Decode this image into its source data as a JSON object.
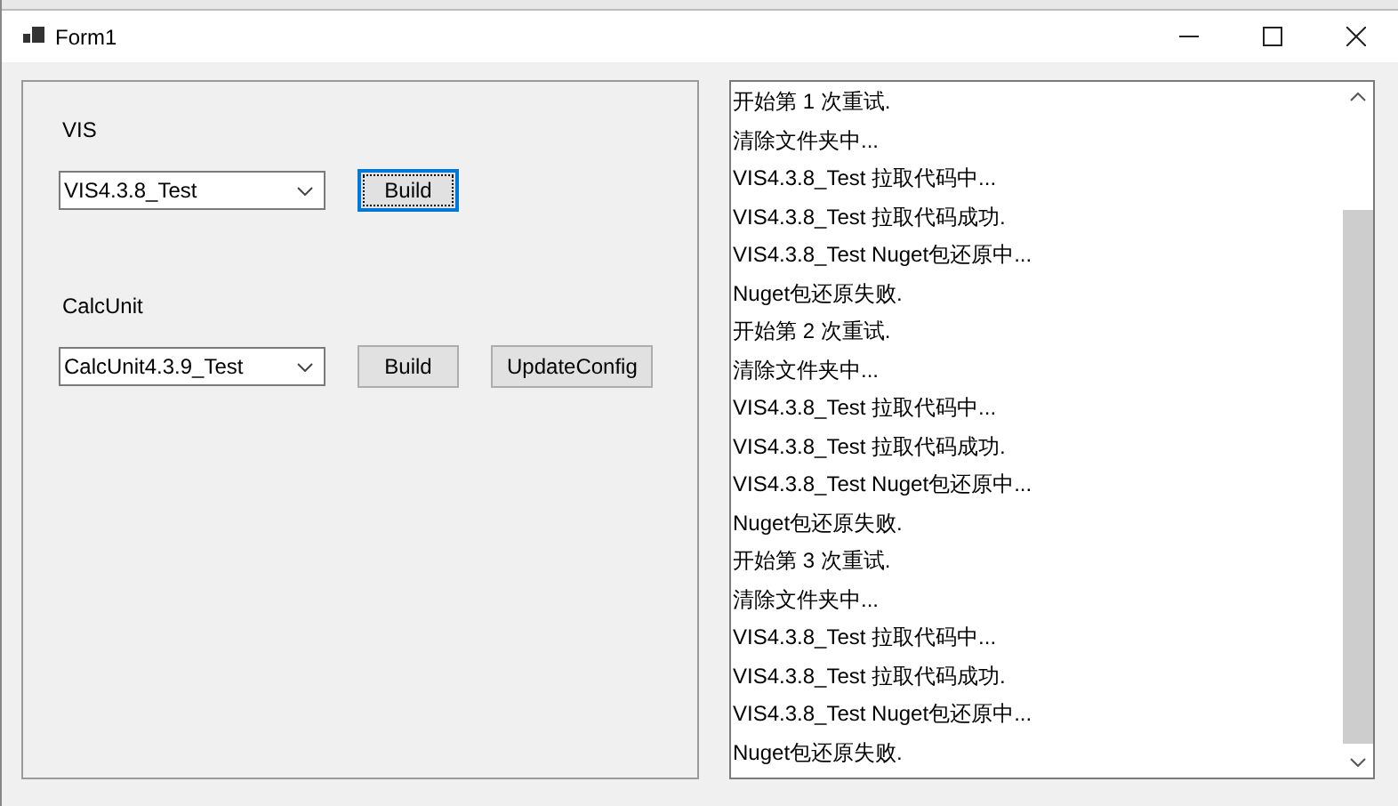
{
  "window": {
    "title": "Form1"
  },
  "groups": [
    {
      "label": "VIS",
      "combo": "VIS4.3.8_Test",
      "buttons": [
        {
          "label": "Build",
          "focused": true
        }
      ]
    },
    {
      "label": "CalcUnit",
      "combo": "CalcUnit4.3.9_Test",
      "buttons": [
        {
          "label": "Build",
          "focused": false
        },
        {
          "label": "UpdateConfig",
          "focused": false
        }
      ]
    }
  ],
  "log": {
    "items": [
      "开始第 1 次重试.",
      "清除文件夹中...",
      "VIS4.3.8_Test 拉取代码中...",
      "VIS4.3.8_Test 拉取代码成功.",
      "VIS4.3.8_Test Nuget包还原中...",
      "Nuget包还原失败.",
      "开始第 2 次重试.",
      "清除文件夹中...",
      "VIS4.3.8_Test 拉取代码中...",
      "VIS4.3.8_Test 拉取代码成功.",
      "VIS4.3.8_Test Nuget包还原中...",
      "Nuget包还原失败.",
      "开始第 3 次重试.",
      "清除文件夹中...",
      "VIS4.3.8_Test 拉取代码中...",
      "VIS4.3.8_Test 拉取代码成功.",
      "VIS4.3.8_Test Nuget包还原中...",
      "Nuget包还原失败."
    ]
  }
}
